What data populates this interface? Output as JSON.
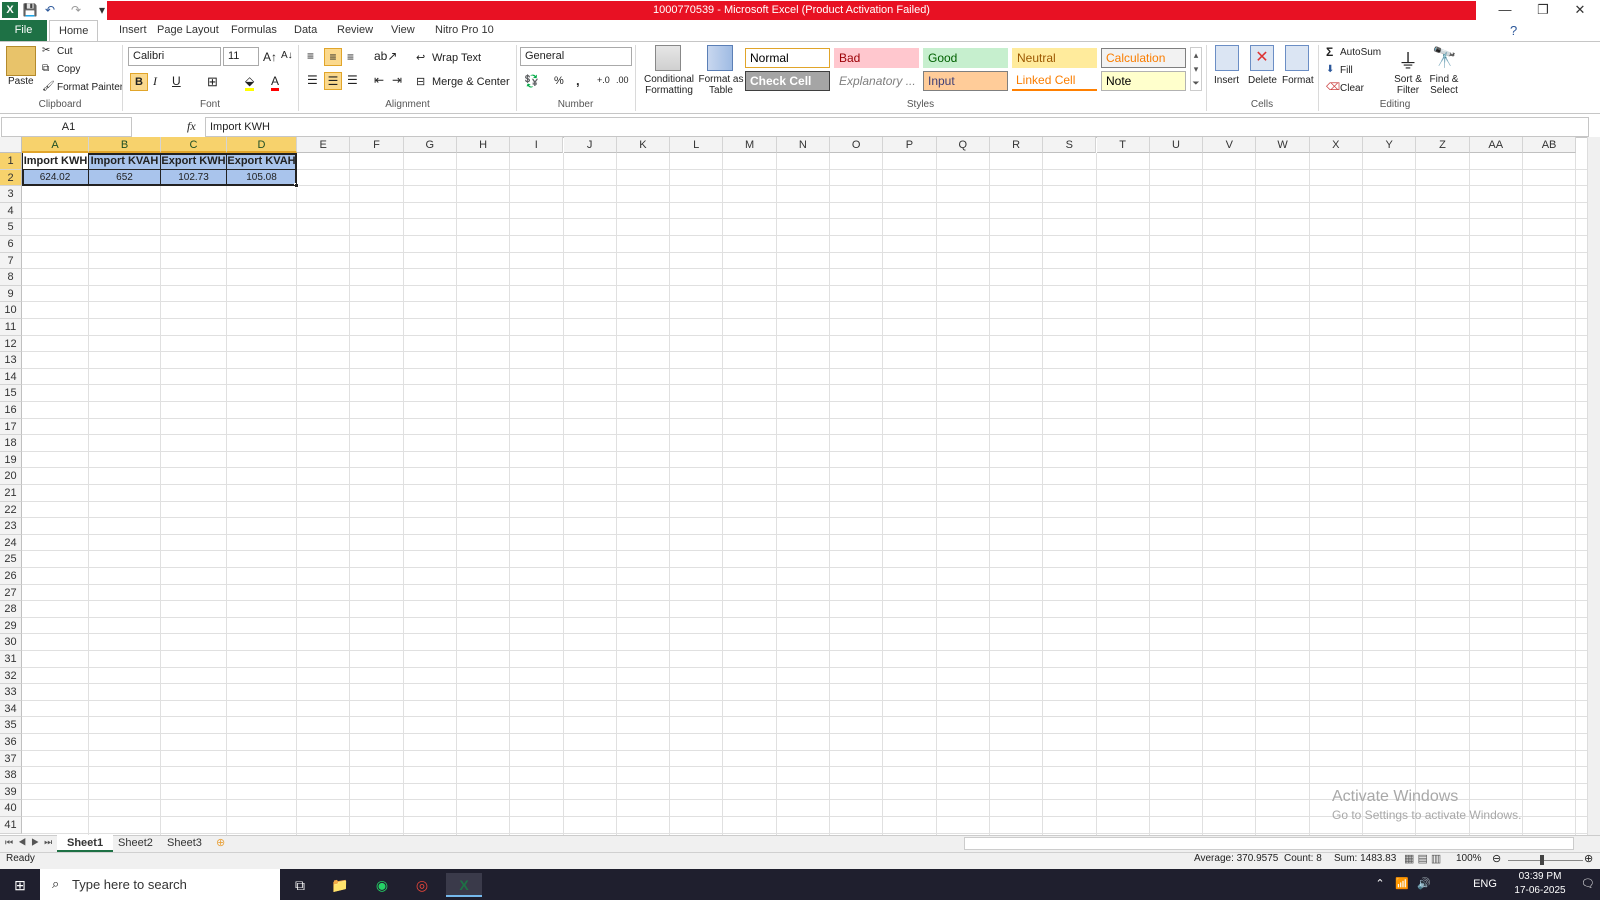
{
  "window": {
    "title": "1000770539  -  Microsoft Excel (Product Activation Failed)",
    "minimize": "—",
    "restore": "❐",
    "close": "✕"
  },
  "tabs": [
    "File",
    "Home",
    "Insert",
    "Page Layout",
    "Formulas",
    "Data",
    "Review",
    "View",
    "Nitro Pro 10"
  ],
  "clipboard": {
    "paste": "Paste",
    "cut": "Cut",
    "copy": "Copy",
    "format_painter": "Format Painter",
    "label": "Clipboard"
  },
  "font": {
    "name": "Calibri",
    "size": "11",
    "bold": "B",
    "italic": "I",
    "underline": "U",
    "label": "Font"
  },
  "alignment": {
    "wrap": "Wrap Text",
    "merge": "Merge & Center",
    "label": "Alignment"
  },
  "number": {
    "format": "General",
    "percent": "%",
    "comma": ",",
    "label": "Number"
  },
  "styles": {
    "conditional": "Conditional Formatting",
    "format_table": "Format as Table",
    "label": "Styles",
    "gallery": [
      {
        "name": "Normal",
        "bg": "#ffffff",
        "fg": "#000000",
        "border": "#e1a52a"
      },
      {
        "name": "Bad",
        "bg": "#ffc7ce",
        "fg": "#9c0006",
        "border": "#ffc7ce"
      },
      {
        "name": "Good",
        "bg": "#c6efce",
        "fg": "#006100",
        "border": "#c6efce"
      },
      {
        "name": "Neutral",
        "bg": "#ffeb9c",
        "fg": "#9c5700",
        "border": "#ffeb9c"
      },
      {
        "name": "Calculation",
        "bg": "#f2f2f2",
        "fg": "#fa7d00",
        "border": "#7f7f7f"
      },
      {
        "name": "Check Cell",
        "bg": "#a5a5a5",
        "fg": "#ffffff",
        "border": "#3f3f3f"
      },
      {
        "name": "Explanatory ...",
        "bg": "#ffffff",
        "fg": "#7f7f7f",
        "border": "#ffffff"
      },
      {
        "name": "Input",
        "bg": "#ffcc99",
        "fg": "#3f3f76",
        "border": "#7f7f7f"
      },
      {
        "name": "Linked Cell",
        "bg": "#ffffff",
        "fg": "#fa7d00",
        "border": "#ff8001"
      },
      {
        "name": "Note",
        "bg": "#ffffcc",
        "fg": "#000000",
        "border": "#b2b2b2"
      }
    ]
  },
  "cells": {
    "insert": "Insert",
    "delete": "Delete",
    "format": "Format",
    "label": "Cells"
  },
  "editing": {
    "autosum": "AutoSum",
    "fill": "Fill",
    "clear": "Clear",
    "sort": "Sort & Filter",
    "find": "Find & Select",
    "label": "Editing"
  },
  "formula_bar": {
    "name_box": "A1",
    "fx": "fx",
    "content": "Import KWH"
  },
  "columns": [
    "A",
    "B",
    "C",
    "D",
    "E",
    "F",
    "G",
    "H",
    "I",
    "J",
    "K",
    "L",
    "M",
    "N",
    "O",
    "P",
    "Q",
    "R",
    "S",
    "T",
    "U",
    "V",
    "W",
    "X",
    "Y",
    "Z",
    "AA",
    "AB"
  ],
  "sheet": {
    "headers": [
      "Import KWH",
      "Import KVAH",
      "Export KWH",
      "Export KVAH"
    ],
    "values": [
      "624.02",
      "652",
      "102.73",
      "105.08"
    ],
    "row_count": 41
  },
  "sheet_tabs": [
    "Sheet1",
    "Sheet2",
    "Sheet3"
  ],
  "status": {
    "ready": "Ready",
    "average": "Average: 370.9575",
    "count": "Count: 8",
    "sum": "Sum: 1483.83",
    "zoom": "100%"
  },
  "watermark": {
    "line1": "Activate Windows",
    "line2": "Go to Settings to activate Windows."
  },
  "taskbar": {
    "search": "Type here to search",
    "lang": "ENG",
    "time": "03:39 PM",
    "date": "17-06-2025"
  },
  "colors": {
    "excel_green": "#1e7145",
    "title_red": "#e81123",
    "selection": "#a9c4ec",
    "header_sel": "#f7d26c"
  }
}
